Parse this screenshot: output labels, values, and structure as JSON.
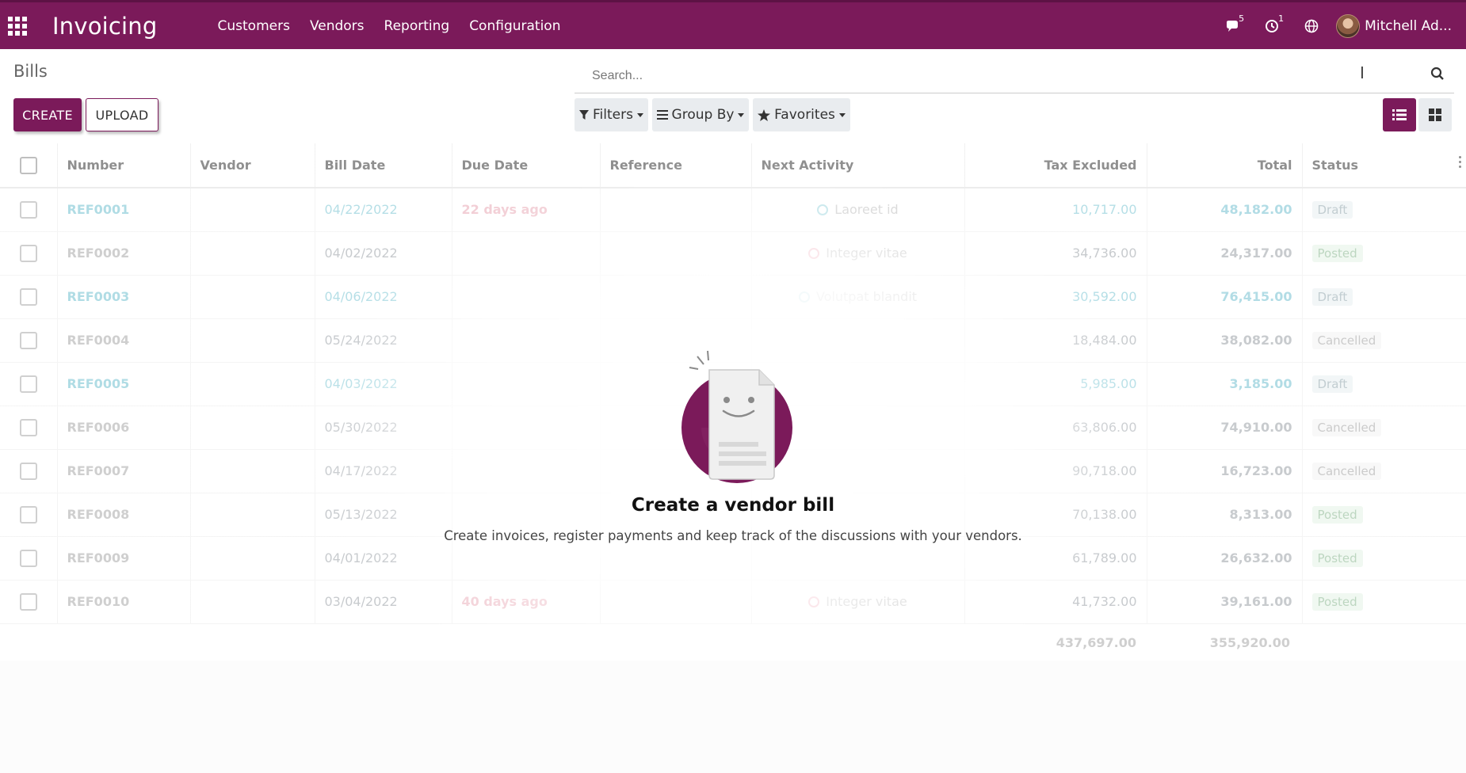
{
  "navbar": {
    "app_name": "Invoicing",
    "menu": [
      "Customers",
      "Vendors",
      "Reporting",
      "Configuration"
    ],
    "messages_count": "5",
    "activities_count": "1",
    "user_name": "Mitchell Ad..."
  },
  "control": {
    "breadcrumb": "Bills",
    "search_placeholder": "Search...",
    "create_label": "CREATE",
    "upload_label": "UPLOAD",
    "filters_label": "Filters",
    "groupby_label": "Group By",
    "favorites_label": "Favorites"
  },
  "table": {
    "headers": {
      "number": "Number",
      "vendor": "Vendor",
      "bill_date": "Bill Date",
      "due_date": "Due Date",
      "reference": "Reference",
      "next_activity": "Next Activity",
      "tax_excluded": "Tax Excluded",
      "total": "Total",
      "status": "Status"
    },
    "rows": [
      {
        "number": "REF0001",
        "bill_date": "04/22/2022",
        "due_date": "22 days ago",
        "next_activity": "Laoreet id",
        "tax_excluded": "10,717.00",
        "total": "48,182.00",
        "status": "Draft"
      },
      {
        "number": "REF0002",
        "bill_date": "04/02/2022",
        "due_date": "",
        "next_activity": "Integer vitae",
        "tax_excluded": "34,736.00",
        "total": "24,317.00",
        "status": "Posted"
      },
      {
        "number": "REF0003",
        "bill_date": "04/06/2022",
        "due_date": "",
        "next_activity": "Volutpat blandit",
        "tax_excluded": "30,592.00",
        "total": "76,415.00",
        "status": "Draft"
      },
      {
        "number": "REF0004",
        "bill_date": "05/24/2022",
        "due_date": "",
        "next_activity": "",
        "tax_excluded": "18,484.00",
        "total": "38,082.00",
        "status": "Cancelled"
      },
      {
        "number": "REF0005",
        "bill_date": "04/03/2022",
        "due_date": "",
        "next_activity": "",
        "tax_excluded": "5,985.00",
        "total": "3,185.00",
        "status": "Draft"
      },
      {
        "number": "REF0006",
        "bill_date": "05/30/2022",
        "due_date": "",
        "next_activity": "",
        "tax_excluded": "63,806.00",
        "total": "74,910.00",
        "status": "Cancelled"
      },
      {
        "number": "REF0007",
        "bill_date": "04/17/2022",
        "due_date": "",
        "next_activity": "",
        "tax_excluded": "90,718.00",
        "total": "16,723.00",
        "status": "Cancelled"
      },
      {
        "number": "REF0008",
        "bill_date": "05/13/2022",
        "due_date": "",
        "next_activity": "",
        "tax_excluded": "70,138.00",
        "total": "8,313.00",
        "status": "Posted"
      },
      {
        "number": "REF0009",
        "bill_date": "04/01/2022",
        "due_date": "",
        "next_activity": "",
        "tax_excluded": "61,789.00",
        "total": "26,632.00",
        "status": "Posted"
      },
      {
        "number": "REF0010",
        "bill_date": "03/04/2022",
        "due_date": "40 days ago",
        "next_activity": "Integer vitae",
        "tax_excluded": "41,732.00",
        "total": "39,161.00",
        "status": "Posted"
      }
    ],
    "footer": {
      "tax_excluded": "437,697.00",
      "total": "355,920.00"
    }
  },
  "help": {
    "title": "Create a vendor bill",
    "subtitle": "Create invoices, register payments and keep track of the discussions with your vendors."
  },
  "colors": {
    "brand": "#7b1a5a"
  }
}
